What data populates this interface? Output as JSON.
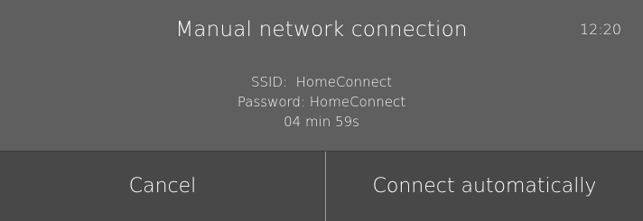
{
  "header": {
    "title": "Manual network connection",
    "time": "12:20"
  },
  "network": {
    "ssid_label": "SSID:",
    "ssid_value": "HomeConnect",
    "password_label": "Password:",
    "password_value": "HomeConnect",
    "countdown": "04 min 59s"
  },
  "actions": {
    "cancel_label": "Cancel",
    "connect_label": "Connect automatically"
  }
}
